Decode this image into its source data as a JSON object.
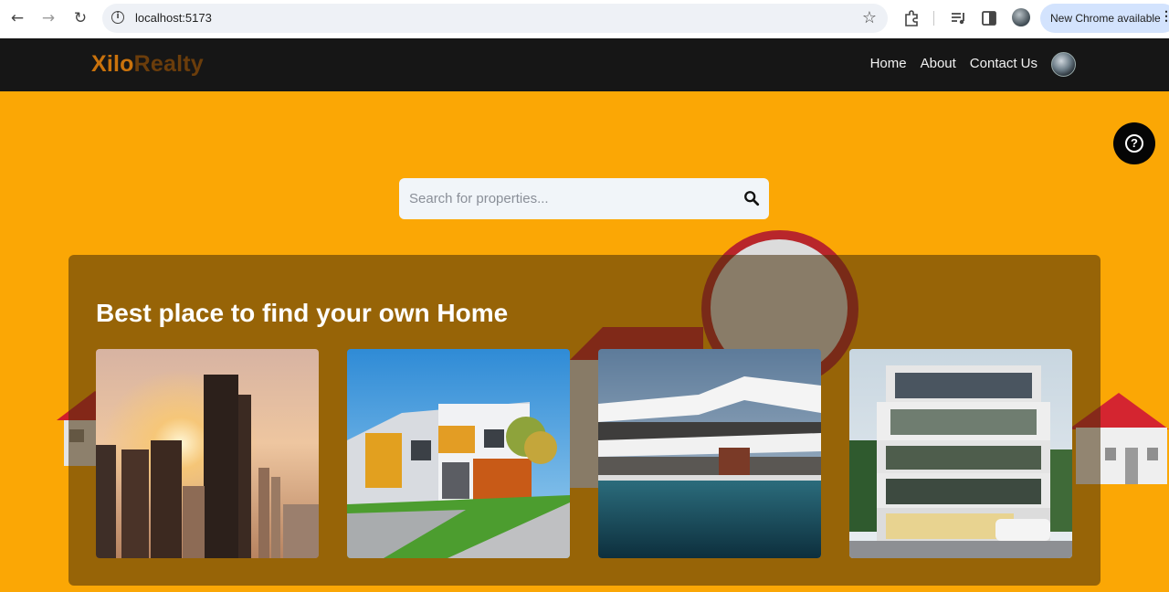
{
  "browser": {
    "url": "localhost:5173",
    "update_label": "New Chrome available",
    "icons": [
      "back-icon",
      "forward-icon",
      "reload-icon",
      "site-info-icon",
      "bookmark-star-icon",
      "extensions-icon",
      "media-controls-icon",
      "side-panel-icon",
      "profile-icon",
      "more-icon"
    ]
  },
  "header": {
    "logo_part1": "Xilo",
    "logo_part2": "Realty",
    "nav": [
      "Home",
      "About",
      "Contact Us"
    ]
  },
  "search": {
    "placeholder": "Search for properties..."
  },
  "panel": {
    "title": "Best place to find your own Home",
    "cards": [
      "city-skyline-sunset",
      "townhouses-with-lawn",
      "modern-villa-with-pool",
      "modern-apartment-building"
    ]
  },
  "colors": {
    "hero_bg": "#fba705",
    "header_bg": "#161616",
    "logo_primary": "#c9720c",
    "logo_secondary": "#6b3d0b",
    "pin_red": "#b8262b"
  }
}
